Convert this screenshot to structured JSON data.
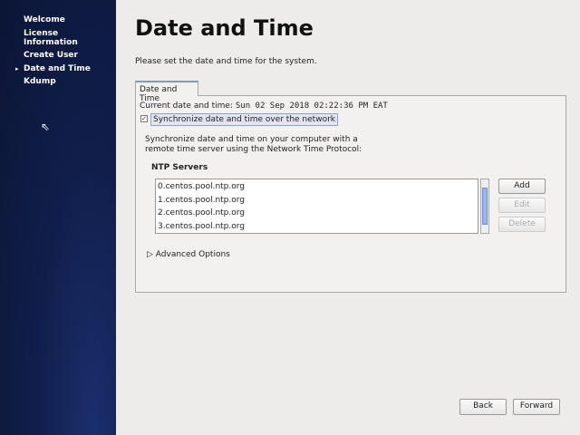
{
  "sidebar": {
    "items": [
      "Welcome",
      "License Information",
      "Create User",
      "Date and Time",
      "Kdump"
    ],
    "active": "Date and Time"
  },
  "header": {
    "title": "Date and Time",
    "subtitle": "Please set the date and time for the system."
  },
  "tab": {
    "label": "Date and Time"
  },
  "current": {
    "label": "Current date and time:",
    "value": "Sun 02 Sep 2018 02:22:36 PM EAT"
  },
  "sync": {
    "label": "Synchronize date and time over the network",
    "checked": true
  },
  "description": "Synchronize date and time on your computer with a remote time server using the Network Time Protocol:",
  "ntp": {
    "heading": "NTP Servers",
    "servers": [
      "0.centos.pool.ntp.org",
      "1.centos.pool.ntp.org",
      "2.centos.pool.ntp.org",
      "3.centos.pool.ntp.org"
    ],
    "add": "Add",
    "edit": "Edit",
    "delete": "Delete"
  },
  "advanced": "Advanced Options",
  "footer": {
    "back": "Back",
    "forward": "Forward"
  }
}
